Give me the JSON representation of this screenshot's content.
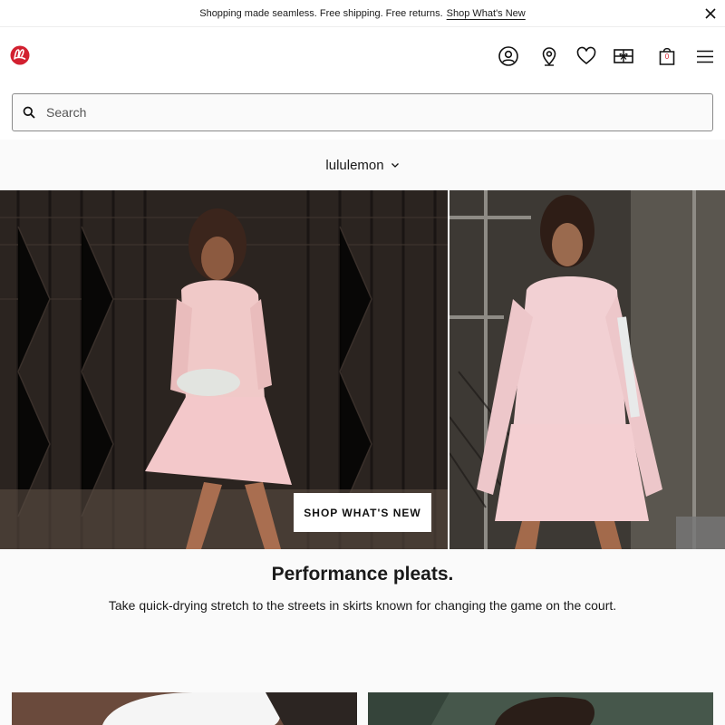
{
  "promo": {
    "text": "Shopping made seamless. Free shipping. Free returns.",
    "link": "Shop What's New",
    "close_icon": "close-icon"
  },
  "header": {
    "logo": "lululemon-logo",
    "icons": [
      "account-icon",
      "store-locator-icon",
      "wishlist-icon",
      "gift-card-icon",
      "bag-icon",
      "menu-icon"
    ],
    "bag_count": "0",
    "accent": "#d22030"
  },
  "search": {
    "placeholder": "Search",
    "icon": "search-icon"
  },
  "brand_selector": {
    "label": "lululemon",
    "icon": "chevron-down-icon"
  },
  "hero": {
    "cta": "SHOP WHAT'S NEW"
  },
  "feature": {
    "title": "Performance pleats.",
    "description": "Take quick-drying stretch to the streets in skirts known for changing the game on the court."
  }
}
